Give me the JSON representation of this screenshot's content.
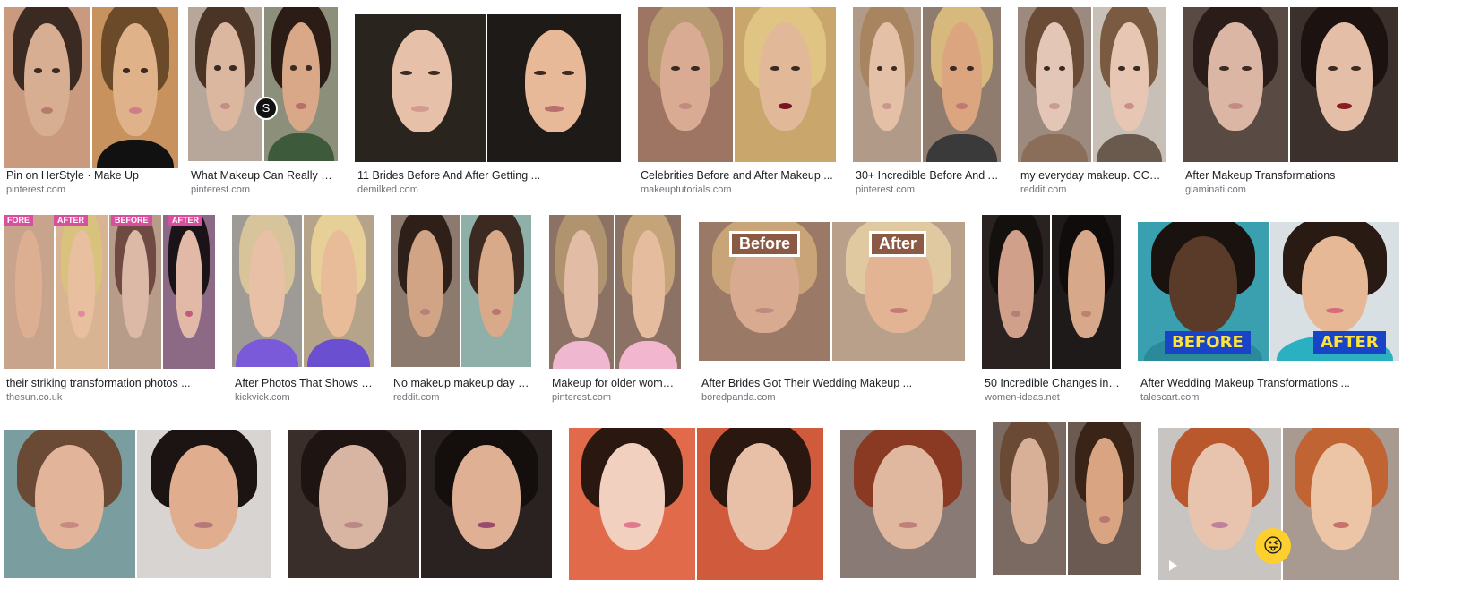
{
  "results": [
    {
      "title": "Pin on HerStyle · Make Up",
      "source": "pinterest.com"
    },
    {
      "title": "What Makeup Can Really Do...",
      "source": "pinterest.com",
      "badge": "S"
    },
    {
      "title": "11 Brides Before And After Getting ...",
      "source": "demilked.com"
    },
    {
      "title": "Celebrities Before and After Makeup ...",
      "source": "makeuptutorials.com"
    },
    {
      "title": "30+ Incredible Before And A...",
      "source": "pinterest.com"
    },
    {
      "title": "my everyday makeup. CCW! ...",
      "source": "reddit.com"
    },
    {
      "title": "After Makeup Transformations",
      "source": "glaminati.com"
    },
    {
      "title": "their striking transformation photos ...",
      "source": "thesun.co.uk",
      "tags": [
        "FORE",
        "AFTER",
        "BEFORE",
        "AFTER"
      ]
    },
    {
      "title": "After Photos That Shows T...",
      "source": "kickvick.com"
    },
    {
      "title": "No makeup makeup day w...",
      "source": "reddit.com"
    },
    {
      "title": "Makeup for older women...",
      "source": "pinterest.com"
    },
    {
      "title": "After Brides Got Their Wedding Makeup ...",
      "source": "boredpanda.com",
      "labels": [
        "Before",
        "After"
      ]
    },
    {
      "title": "50 Incredible Changes in ...",
      "source": "women-ideas.net"
    },
    {
      "title": "After Wedding Makeup Transformations ...",
      "source": "talescart.com",
      "labels": [
        "BEFORE",
        "AFTER"
      ]
    },
    {
      "title": "",
      "source": ""
    },
    {
      "title": "",
      "source": ""
    },
    {
      "title": "",
      "source": ""
    },
    {
      "title": "",
      "source": ""
    },
    {
      "title": "",
      "source": ""
    },
    {
      "title": "",
      "source": "",
      "emoji": "😜"
    }
  ],
  "icons": {
    "play": "play-icon",
    "emoji": "emoji-sticker-icon"
  }
}
